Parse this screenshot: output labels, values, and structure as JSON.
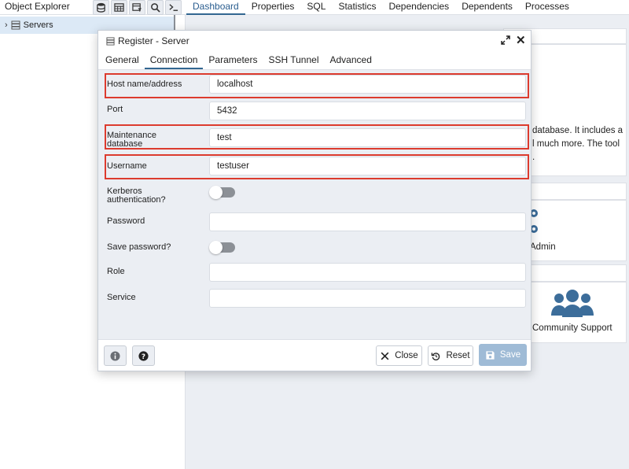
{
  "topbar": {
    "object_explorer_title": "Object Explorer",
    "tools": [
      "database-icon",
      "table-icon",
      "filter-icon",
      "search-icon",
      "terminal-icon"
    ],
    "tabs": [
      "Dashboard",
      "Properties",
      "SQL",
      "Statistics",
      "Dependencies",
      "Dependents",
      "Processes"
    ],
    "active_tab": "Dashboard"
  },
  "tree": {
    "servers_label": "Servers"
  },
  "background": {
    "welcome_line1": "database. It includes a",
    "welcome_line2": "l much more. The tool",
    "welcome_line3": ".",
    "admin_label": "Admin",
    "community_label": "Community Support"
  },
  "dialog": {
    "title": "Register - Server",
    "tabs": [
      "General",
      "Connection",
      "Parameters",
      "SSH Tunnel",
      "Advanced"
    ],
    "active_tab": "Connection",
    "fields": {
      "host": {
        "label": "Host name/address",
        "value": "localhost"
      },
      "port": {
        "label": "Port",
        "value": "5432"
      },
      "maintenance": {
        "label_line1": "Maintenance",
        "label_line2": "database",
        "value": "test"
      },
      "username": {
        "label": "Username",
        "value": "testuser"
      },
      "kerberos": {
        "label_line1": "Kerberos",
        "label_line2": "authentication?",
        "enabled": false
      },
      "password": {
        "label": "Password",
        "value": ""
      },
      "save_password": {
        "label": "Save password?",
        "enabled": false
      },
      "role": {
        "label": "Role",
        "value": ""
      },
      "service": {
        "label": "Service",
        "value": ""
      }
    },
    "footer": {
      "close_label": "Close",
      "reset_label": "Reset",
      "save_label": "Save"
    },
    "colors": {
      "highlight": "#dc3b2e",
      "accent": "#326690",
      "save_disabled": "#9fbbd6"
    }
  }
}
